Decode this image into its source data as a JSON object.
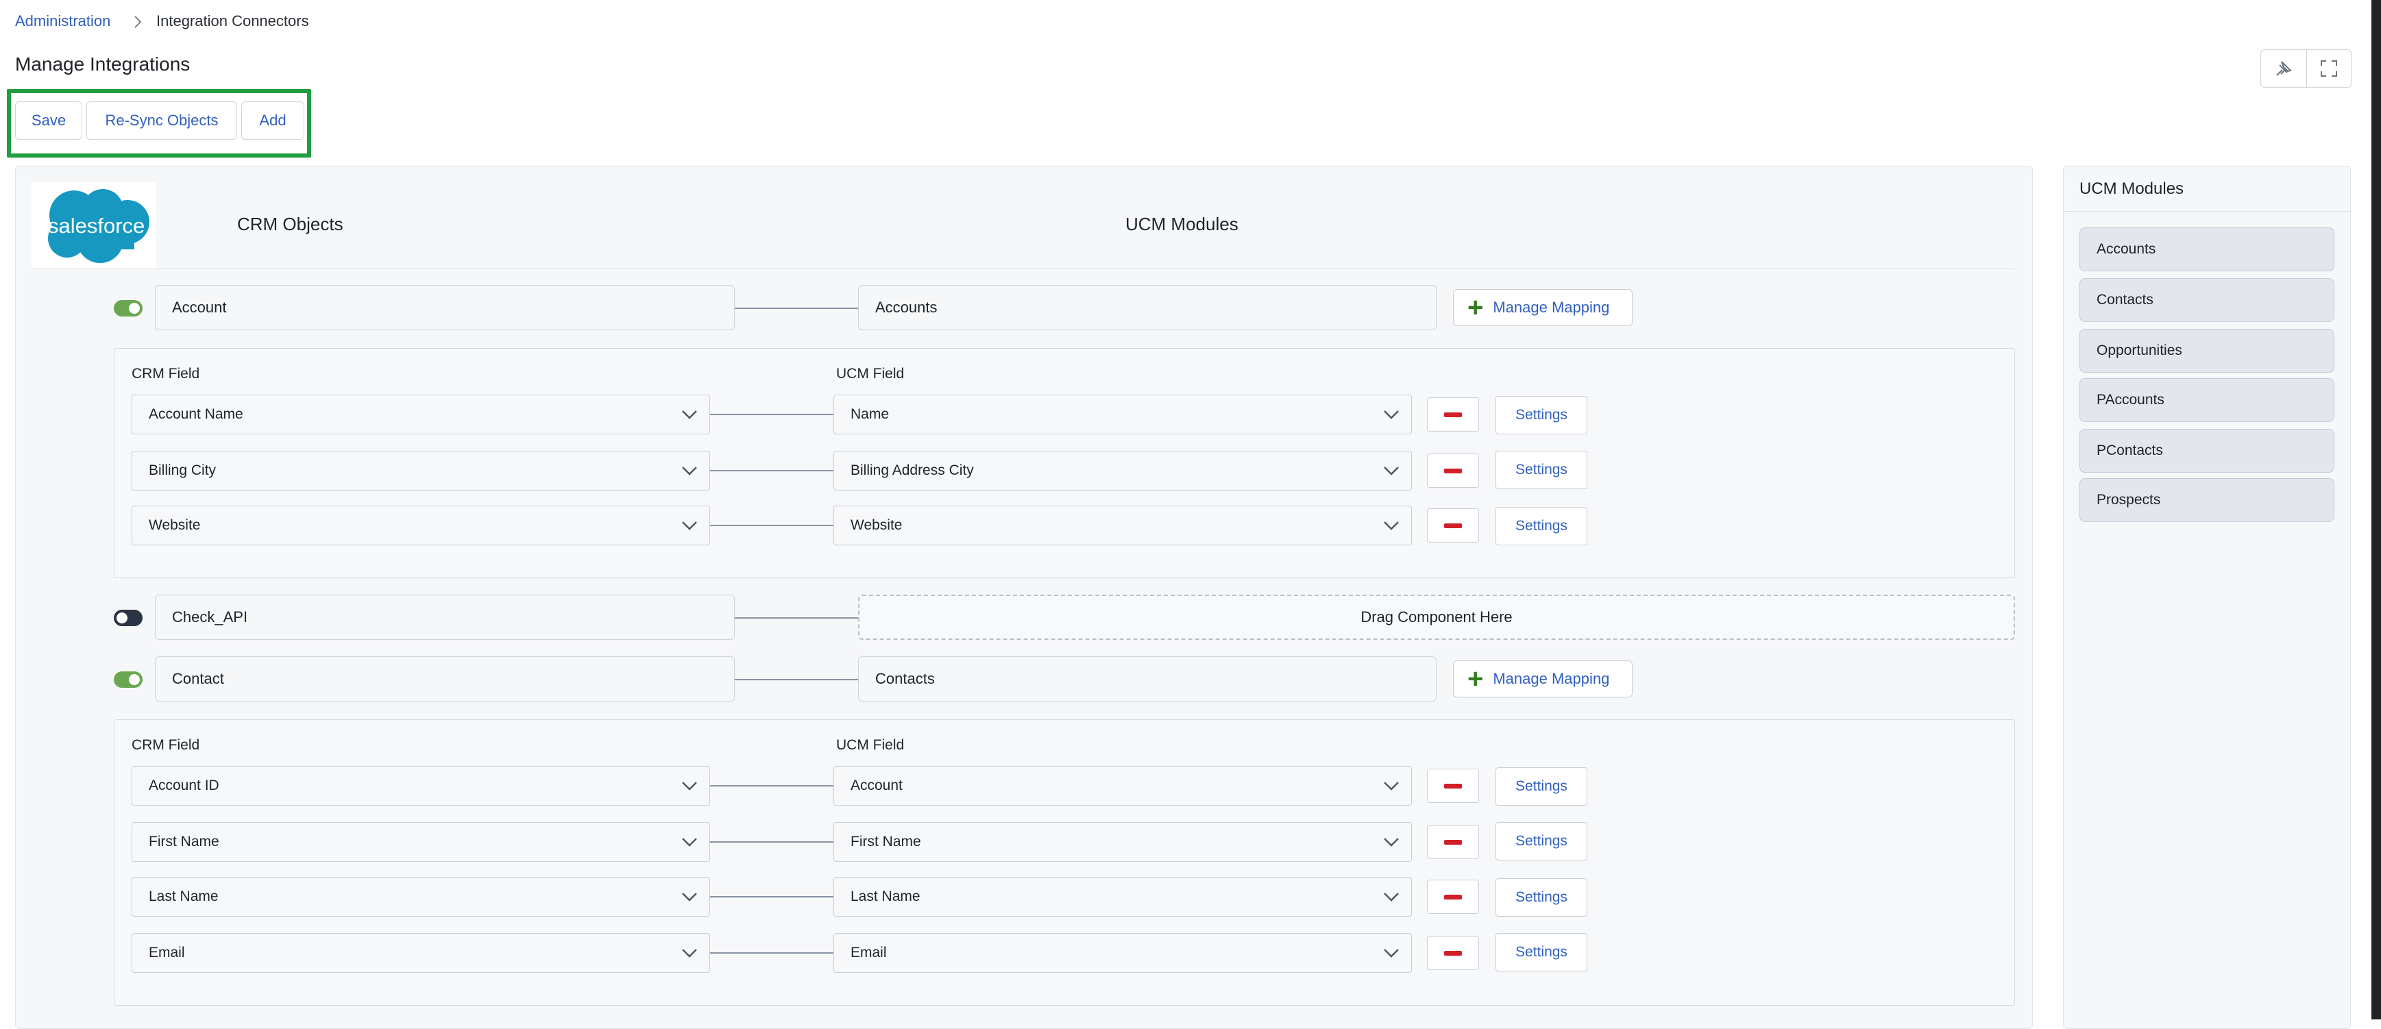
{
  "breadcrumb": {
    "root": "Administration",
    "current": "Integration Connectors"
  },
  "page": {
    "title": "Manage Integrations"
  },
  "toolbar": {
    "save": "Save",
    "resync": "Re-Sync Objects",
    "add": "Add"
  },
  "header": {
    "crm_objects": "CRM Objects",
    "ucm_modules": "UCM Modules",
    "logo_text": "salesforce"
  },
  "objects": {
    "account": {
      "crm": "Account",
      "ucm": "Accounts",
      "enabled": true,
      "manage_label": "Manage Mapping",
      "crm_field_header": "CRM Field",
      "ucm_field_header": "UCM Field",
      "rows": [
        {
          "crm": "Account Name",
          "ucm": "Name",
          "settings": "Settings"
        },
        {
          "crm": "Billing City",
          "ucm": "Billing Address City",
          "settings": "Settings"
        },
        {
          "crm": "Website",
          "ucm": "Website",
          "settings": "Settings"
        }
      ]
    },
    "check_api": {
      "crm": "Check_API",
      "enabled": false,
      "drop_label": "Drag Component Here"
    },
    "contact": {
      "crm": "Contact",
      "ucm": "Contacts",
      "enabled": true,
      "manage_label": "Manage Mapping",
      "crm_field_header": "CRM Field",
      "ucm_field_header": "UCM Field",
      "rows": [
        {
          "crm": "Account ID",
          "ucm": "Account",
          "settings": "Settings"
        },
        {
          "crm": "First Name",
          "ucm": "First Name",
          "settings": "Settings"
        },
        {
          "crm": "Last Name",
          "ucm": "Last Name",
          "settings": "Settings"
        },
        {
          "crm": "Email",
          "ucm": "Email",
          "settings": "Settings"
        }
      ]
    }
  },
  "side_panel": {
    "title": "UCM Modules",
    "modules": [
      "Accounts",
      "Contacts",
      "Opportunities",
      "PAccounts",
      "PContacts",
      "Prospects"
    ]
  },
  "icons": {
    "pin": "pin-icon",
    "fullscreen": "fullscreen-icon",
    "chevron": "chevron-down-icon",
    "plus": "plus-icon",
    "remove": "minus-icon",
    "separator": "chevron-right-icon"
  },
  "colors": {
    "accent": "#2f5fbf",
    "highlight": "#1f9d3f",
    "toggle_on": "#6aa84f",
    "toggle_off": "#2b3445",
    "remove": "#d11f2a",
    "salesforce": "#1798c1"
  }
}
